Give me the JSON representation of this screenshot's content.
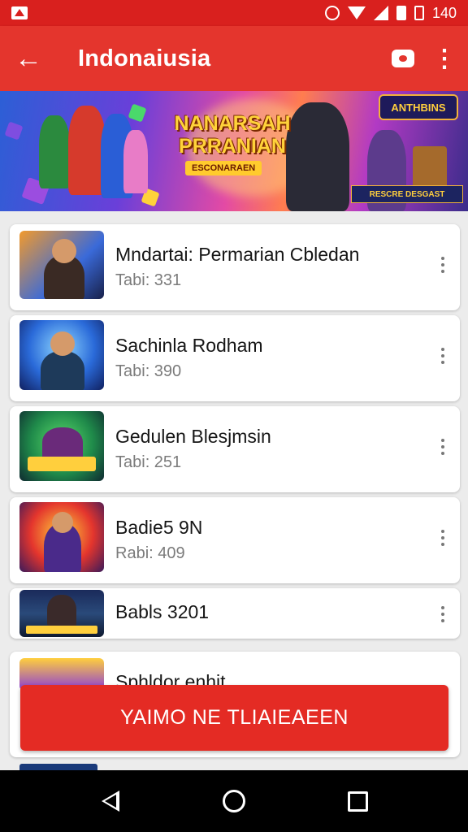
{
  "status_bar": {
    "time": "140",
    "icons": [
      "app-icon",
      "alarm-icon",
      "wifi-icon",
      "signal-icon",
      "battery-icon",
      "battery-icon"
    ]
  },
  "app_bar": {
    "title": "Indonaiusia",
    "back_icon": "arrow-left-icon",
    "back_glyph": "←",
    "chat_icon": "chat-icon",
    "more_icon": "more-vertical-icon",
    "more_glyph": "⋮"
  },
  "banner": {
    "title_line1": "NANARSAH",
    "title_line2": "PRRANIAN",
    "subtitle": "ESCONARAEN",
    "logo": "ANTHBINS",
    "tag": "RESCRE DESGAST"
  },
  "items": [
    {
      "title": "Mndartai: Permarian Cbledan",
      "subtitle": "Tabi: 331"
    },
    {
      "title": "Sachinla Rodham",
      "subtitle": "Tabi: 390"
    },
    {
      "title": "Gedulen Blesjmsin",
      "subtitle": "Tabi: 251"
    },
    {
      "title": "Badie5 9N",
      "subtitle": "Rabi: 409"
    },
    {
      "title": "Babls 3201",
      "subtitle": ""
    },
    {
      "title": "Sphldor enhit",
      "subtitle": ""
    }
  ],
  "cta": {
    "label": "YAIMO NE TLIAIEAEEN"
  },
  "colors": {
    "status_bar": "#d9201e",
    "app_bar": "#e4352d",
    "accent": "#e42b24",
    "background": "#ececec",
    "nav_bar": "#000000"
  },
  "nav_bar": {
    "icons": [
      "back-triangle-icon",
      "home-circle-icon",
      "recents-square-icon"
    ]
  }
}
